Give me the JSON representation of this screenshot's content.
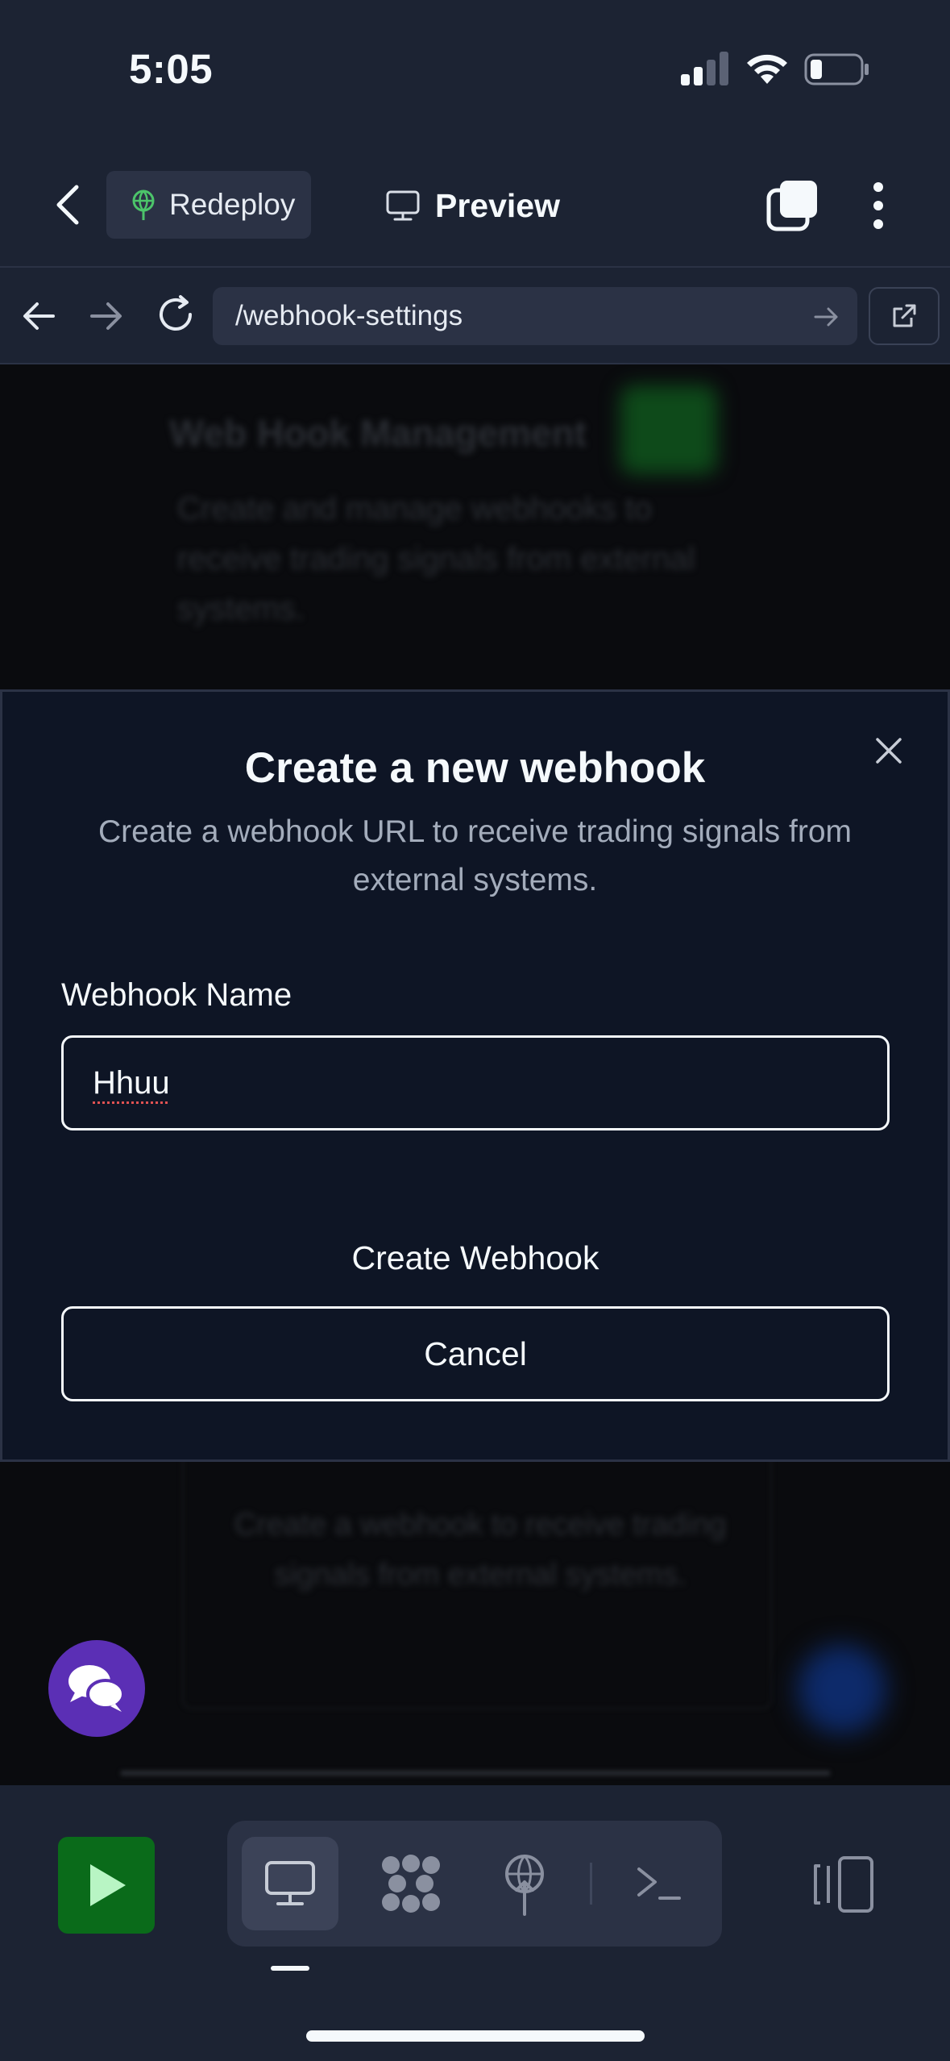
{
  "status_bar": {
    "time": "5:05"
  },
  "header": {
    "redeploy_label": "Redeploy",
    "preview_label": "Preview"
  },
  "browser": {
    "url": "/webhook-settings"
  },
  "background_page": {
    "title": "Web Hook Management",
    "description": "Create and manage webhooks to receive trading signals from external systems.",
    "empty_state": "Create a webhook to receive trading signals from external systems."
  },
  "modal": {
    "title": "Create a new webhook",
    "description": "Create a webhook URL to receive trading signals from external systems.",
    "field_label": "Webhook Name",
    "field_value": "Hhuu",
    "create_label": "Create Webhook",
    "cancel_label": "Cancel"
  },
  "colors": {
    "accent_green": "#0a6b1a",
    "chat_purple": "#5b2fb5",
    "modal_bg": "#0e1525",
    "chrome_bg": "#1c2333"
  },
  "icons": {
    "redeploy": "globe-antenna-icon",
    "preview": "monitor-icon",
    "tabs": "tabs-icon",
    "more": "more-vertical-icon",
    "chat": "chat-bubbles-icon",
    "run": "play-icon",
    "webview": "monitor-icon",
    "workspace": "cluster-icon",
    "deploy": "deploy-icon",
    "shell": "terminal-icon",
    "split": "split-panel-icon"
  }
}
